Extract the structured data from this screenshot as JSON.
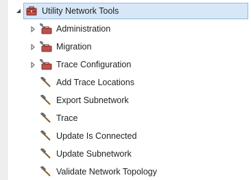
{
  "tree": {
    "root": {
      "label": "Utility Network Tools",
      "icon": "toolbox-icon",
      "expanded": true
    },
    "items": [
      {
        "label": "Administration",
        "icon": "toolset-icon",
        "type": "toolset",
        "expanded": false
      },
      {
        "label": "Migration",
        "icon": "toolset-icon",
        "type": "toolset",
        "expanded": false
      },
      {
        "label": "Trace Configuration",
        "icon": "toolset-icon",
        "type": "toolset",
        "expanded": false
      },
      {
        "label": "Add Trace Locations",
        "icon": "hammer-icon",
        "type": "tool"
      },
      {
        "label": "Export Subnetwork",
        "icon": "hammer-icon",
        "type": "tool"
      },
      {
        "label": "Trace",
        "icon": "hammer-icon",
        "type": "tool"
      },
      {
        "label": "Update Is Connected",
        "icon": "hammer-icon",
        "type": "tool"
      },
      {
        "label": "Update Subnetwork",
        "icon": "hammer-icon",
        "type": "tool"
      },
      {
        "label": "Validate Network Topology",
        "icon": "hammer-icon",
        "type": "tool"
      }
    ]
  },
  "colors": {
    "selection_bg": "#d7e7f7",
    "selection_border": "#8fb8e0",
    "toolbox_red": "#c0504d",
    "hammer_brown": "#8a5a2b"
  }
}
